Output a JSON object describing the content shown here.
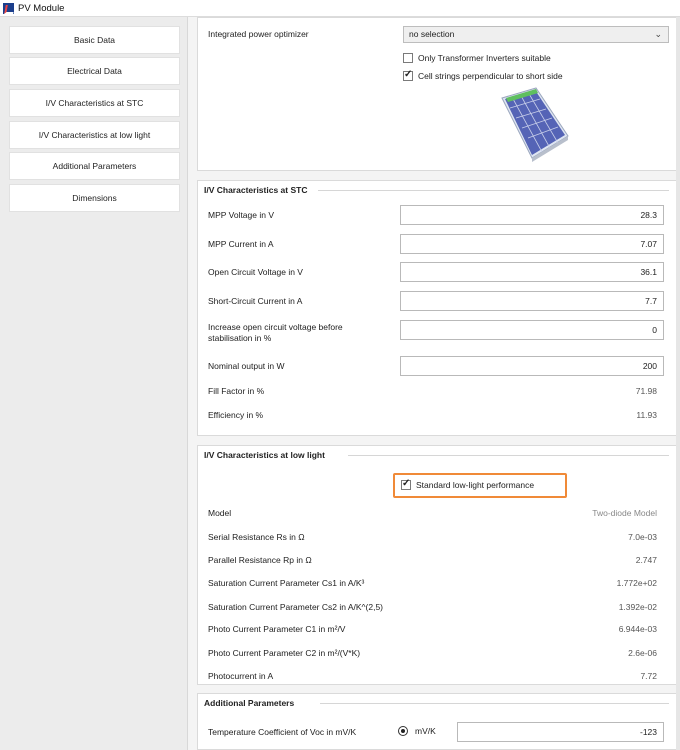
{
  "window": {
    "title": "PV Module"
  },
  "sidebar": {
    "items": [
      {
        "label": "Basic Data"
      },
      {
        "label": "Electrical Data"
      },
      {
        "label": "I/V Characteristics at STC"
      },
      {
        "label": "I/V Characteristics at low light"
      },
      {
        "label": "Additional Parameters"
      },
      {
        "label": "Dimensions"
      }
    ]
  },
  "top_panel": {
    "optimizer_label": "Integrated power optimizer",
    "optimizer_value": "no selection",
    "only_transformer_label": "Only Transformer Inverters suitable",
    "only_transformer_checked": false,
    "cell_strings_label": "Cell strings perpendicular to short side",
    "cell_strings_checked": true
  },
  "stc": {
    "title": "I/V Characteristics at STC",
    "mpp_voltage_label": "MPP Voltage in V",
    "mpp_voltage": "28.3",
    "mpp_current_label": "MPP Current in A",
    "mpp_current": "7.07",
    "voc_label": "Open Circuit Voltage in V",
    "voc": "36.1",
    "isc_label": "Short-Circuit Current in A",
    "isc": "7.7",
    "increase_voc_label_1": "Increase open circuit voltage before",
    "increase_voc_label_2": "stabilisation  in %",
    "increase_voc": "0",
    "nominal_label": "Nominal output in W",
    "nominal": "200",
    "fill_factor_label": "Fill Factor in %",
    "fill_factor": "71.98",
    "efficiency_label": "Efficiency in %",
    "efficiency": "11.93"
  },
  "lowlight": {
    "title": "I/V Characteristics at low light",
    "standard_label": "Standard low-light performance",
    "standard_checked": true,
    "model_label": "Model",
    "model": "Two-diode Model",
    "rs_label": "Serial Resistance Rs in Ω",
    "rs": "7.0e-03",
    "rp_label": "Parallel Resistance Rp in Ω",
    "rp": "2.747",
    "cs1_label": "Saturation Current Parameter Cs1 in A/K³",
    "cs1": "1.772e+02",
    "cs2_label": "Saturation Current Parameter Cs2 in A/K^(2,5)",
    "cs2": "1.392e-02",
    "c1_label": "Photo Current Parameter C1 in m²/V",
    "c1": "6.944e-03",
    "c2_label": "Photo Current Parameter C2 in m²/(V*K)",
    "c2": "2.6e-06",
    "photocurrent_label": "Photocurrent in A",
    "photocurrent": "7.72"
  },
  "additional": {
    "title": "Additional Parameters",
    "temp_coef_label": "Temperature Coefficient of Voc in mV/K",
    "unit_option": "mV/K",
    "temp_coef": "-123"
  },
  "colors": {
    "highlight": "#f08a38",
    "panel_bg": "#ffffff",
    "sidebar_bg": "#ececec"
  }
}
